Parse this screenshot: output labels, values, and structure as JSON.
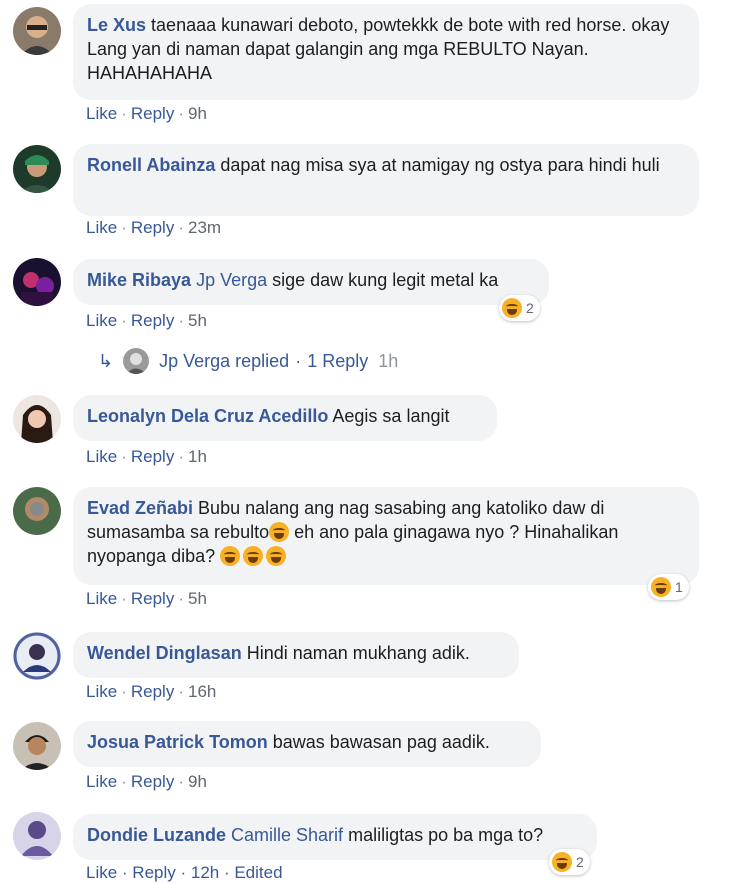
{
  "comments": [
    {
      "author": "Le Xus",
      "text": "taenaaa kunawari deboto, powtekkk de bote with red horse. okay Lang yan di naman dapat galangin ang mga REBULTO Nayan. HAHAHAHAHA",
      "like": "Like",
      "reply": "Reply",
      "time": "9h"
    },
    {
      "author": "Ronell Abainza",
      "text": "dapat nag misa sya at namigay ng ostya para hindi huli",
      "like": "Like",
      "reply": "Reply",
      "time": "23m"
    },
    {
      "author": "Mike Ribaya",
      "mention": "Jp Verga",
      "text": "sige daw kung legit metal ka",
      "like": "Like",
      "reply": "Reply",
      "time": "5h",
      "reaction_count": "2"
    },
    {
      "author": "Leonalyn Dela Cruz Acedillo",
      "text": "Aegis sa langit",
      "like": "Like",
      "reply": "Reply",
      "time": "1h"
    },
    {
      "author": "Evad Zeñabi",
      "text1": "Bubu nalang ang nag sasabing ang katoliko daw di sumasamba sa rebulto",
      "text2": " eh ano pala ginagawa nyo ? Hinahalikan nyopanga diba? ",
      "like": "Like",
      "reply": "Reply",
      "time": "5h",
      "reaction_count": "1"
    },
    {
      "author": "Wendel Dinglasan",
      "text": "Hindi naman mukhang adik.",
      "like": "Like",
      "reply": "Reply",
      "time": "16h"
    },
    {
      "author": "Josua Patrick Tomon",
      "text": "bawas bawasan pag aadik.",
      "like": "Like",
      "reply": "Reply",
      "time": "9h"
    },
    {
      "author": "Dondie Luzande",
      "mention": "Camille Sharif",
      "text": "maliligtas po ba mga to?",
      "reaction_count": "2",
      "partial_actions": "Like · Reply · 12h · Edited"
    }
  ],
  "reply_summary": {
    "name": "Jp Verga replied",
    "count": "1 Reply",
    "time": "1h"
  },
  "icons": {
    "reply_arrow": "reply-arrow-icon",
    "reaction": "haha-emoji-icon"
  },
  "colors": {
    "link": "#385898",
    "bubble": "#f2f3f5",
    "meta": "#606770"
  }
}
